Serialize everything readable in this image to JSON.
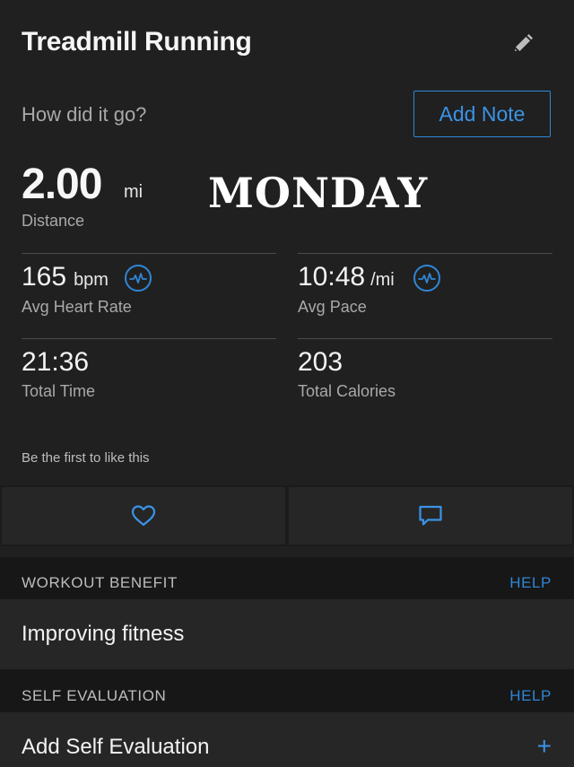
{
  "header": {
    "title": "Treadmill Running"
  },
  "note": {
    "prompt": "How did it go?",
    "add_note_label": "Add Note"
  },
  "distance": {
    "value": "2.00",
    "unit": "mi",
    "label": "Distance"
  },
  "overlay_text": "MONDAY",
  "stats": {
    "heart_rate": {
      "value": "165",
      "unit": "bpm",
      "label": "Avg Heart Rate"
    },
    "pace": {
      "value": "10:48",
      "unit": "/mi",
      "label": "Avg Pace"
    },
    "time": {
      "value": "21:36",
      "label": "Total Time"
    },
    "calories": {
      "value": "203",
      "label": "Total Calories"
    }
  },
  "social": {
    "likes_text": "Be the first to like this"
  },
  "workout_benefit": {
    "title": "WORKOUT BENEFIT",
    "help": "HELP",
    "value": "Improving fitness"
  },
  "self_evaluation": {
    "title": "SELF EVALUATION",
    "help": "HELP",
    "action": "Add Self Evaluation",
    "add_symbol": "+"
  },
  "colors": {
    "accent": "#2f86d6",
    "background": "#202020",
    "section_bg": "#171717",
    "row_bg": "#262626"
  },
  "icons": {
    "edit": "pencil-icon",
    "hr": "heart-rate-icon",
    "like": "heart-icon",
    "comment": "comment-icon"
  }
}
